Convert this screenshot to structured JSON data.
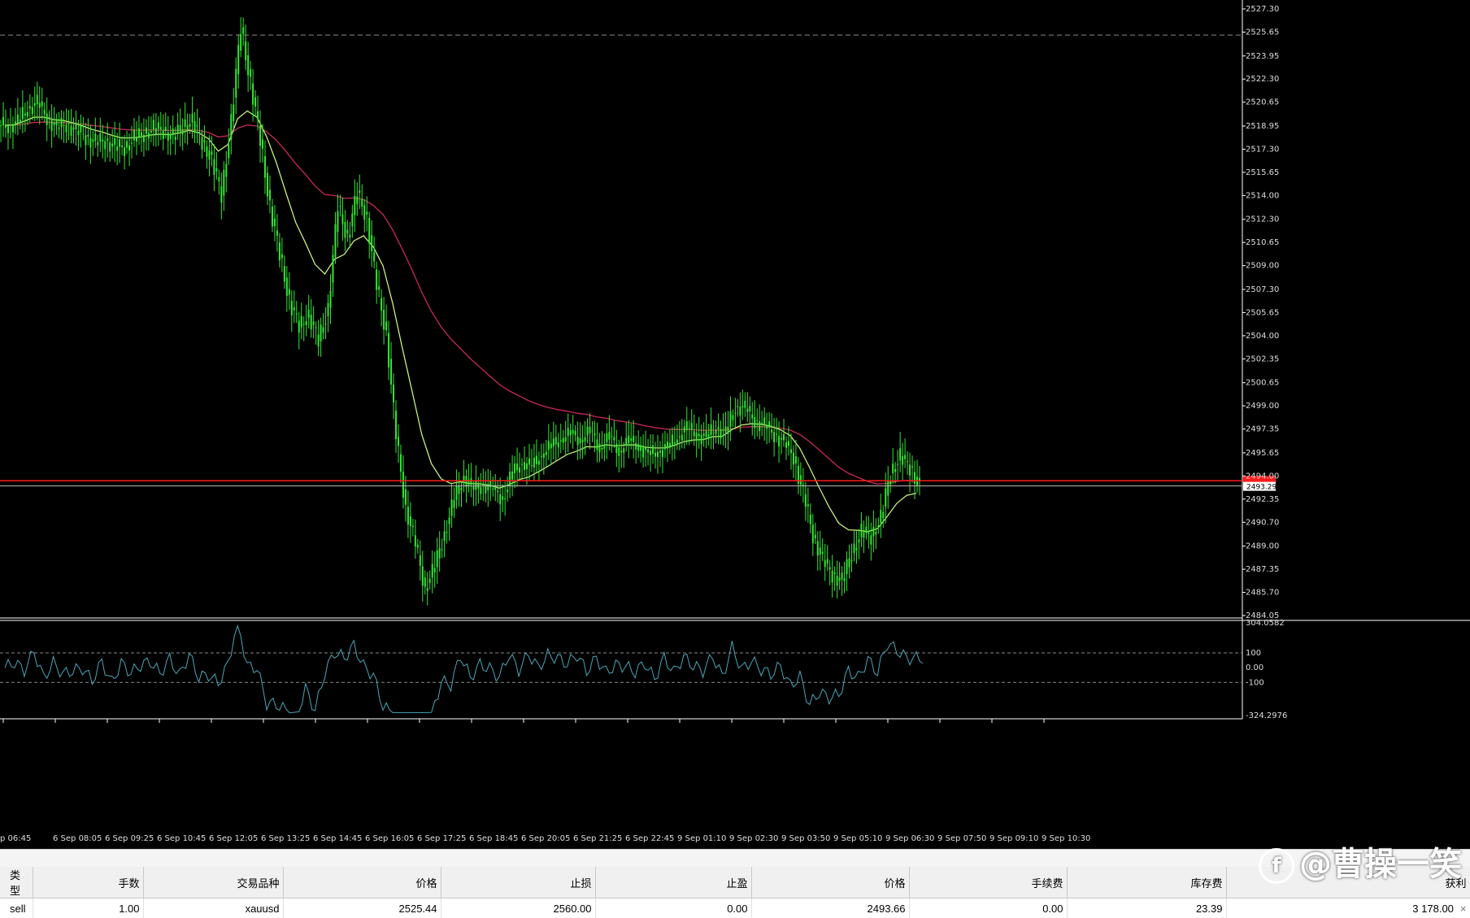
{
  "chart": {
    "symbol": "xauusd",
    "price_axis_labels": [
      "2527.30",
      "2525.65",
      "2523.95",
      "2522.30",
      "2520.65",
      "2518.95",
      "2517.30",
      "2515.65",
      "2514.00",
      "2512.30",
      "2510.65",
      "2509.00",
      "2507.30",
      "2505.65",
      "2504.00",
      "2502.35",
      "2500.65",
      "2499.00",
      "2497.35",
      "2495.65",
      "2494.00",
      "2492.35",
      "2490.70",
      "2489.00",
      "2487.35",
      "2485.70",
      "2484.05"
    ],
    "current_price_tag": "2493.29",
    "time_labels": [
      "p 06:45",
      "6 Sep 08:05",
      "6 Sep 09:25",
      "6 Sep 10:45",
      "6 Sep 12:05",
      "6 Sep 13:25",
      "6 Sep 14:45",
      "6 Sep 16:05",
      "6 Sep 17:25",
      "6 Sep 18:45",
      "6 Sep 20:05",
      "6 Sep 21:25",
      "6 Sep 22:45",
      "9 Sep 01:10",
      "9 Sep 02:30",
      "9 Sep 03:50",
      "9 Sep 05:10",
      "9 Sep 06:30",
      "9 Sep 07:50",
      "9 Sep 09:10",
      "9 Sep 10:30"
    ],
    "indicator_axis_labels": [
      "304.0582",
      "100",
      "0.00",
      "-100",
      "-324.2976"
    ],
    "colors": {
      "bars": "#32e832",
      "ma_fast": "#c8f07a",
      "ma_slow": "#c8285a",
      "order_line": "#ff1a1a",
      "indicator_line": "#4aa6b8",
      "grid_dash": "#8a8a8a"
    }
  },
  "chart_data": {
    "type": "line",
    "ylim": [
      2484.05,
      2527.3
    ],
    "series": [
      {
        "values": [
          2519.0,
          2519.2,
          2520.2,
          2520.6,
          2519.6,
          2518.8,
          2519.1,
          2518.6,
          2518.2,
          2517.8,
          2517.9,
          2517.5,
          2517.4,
          2518.1,
          2518.4,
          2518.8,
          2518.6,
          2518.2,
          2518.9,
          2519.3,
          2517.8,
          2516.6,
          2514.0,
          2519.3,
          2526.0,
          2522.0,
          2518.0,
          2513.2,
          2509.8,
          2506.5,
          2504.6,
          2505.5,
          2503.6,
          2506.0,
          2513.2,
          2511.0,
          2514.2,
          2512.4,
          2507.5,
          2504.2,
          2496.8,
          2491.8,
          2489.1,
          2486.0,
          2487.5,
          2490.0,
          2492.3,
          2494.0,
          2493.0,
          2493.4,
          2493.0,
          2492.4,
          2494.2,
          2495.0,
          2494.6,
          2495.6,
          2496.1,
          2496.7,
          2497.0,
          2496.6,
          2497.2,
          2496.0,
          2496.8,
          2495.8,
          2496.5,
          2496.2,
          2495.5,
          2495.8,
          2496.0,
          2496.8,
          2497.4,
          2497.0,
          2496.7,
          2497.5,
          2497.0,
          2499.0,
          2498.8,
          2498.0,
          2497.6,
          2497.0,
          2496.4,
          2495.4,
          2492.7,
          2489.8,
          2488.0,
          2487.0,
          2486.5,
          2488.5,
          2490.0,
          2489.7,
          2491.0,
          2494.2,
          2495.4,
          2494.6,
          2493.3
        ]
      },
      {
        "values": []
      },
      {
        "values": []
      }
    ]
  },
  "positions_table": {
    "headers": [
      "类型",
      "手数",
      "交易品种",
      "价格",
      "止损",
      "止盈",
      "价格",
      "手续费",
      "库存费",
      "获利"
    ],
    "row": [
      "sell",
      "1.00",
      "xauusd",
      "2525.44",
      "2560.00",
      "0.00",
      "2493.66",
      "0.00",
      "23.39",
      "3 178.00"
    ],
    "close_symbol": "×"
  },
  "watermark": {
    "logo": "f",
    "text": "@曹操一笑"
  }
}
